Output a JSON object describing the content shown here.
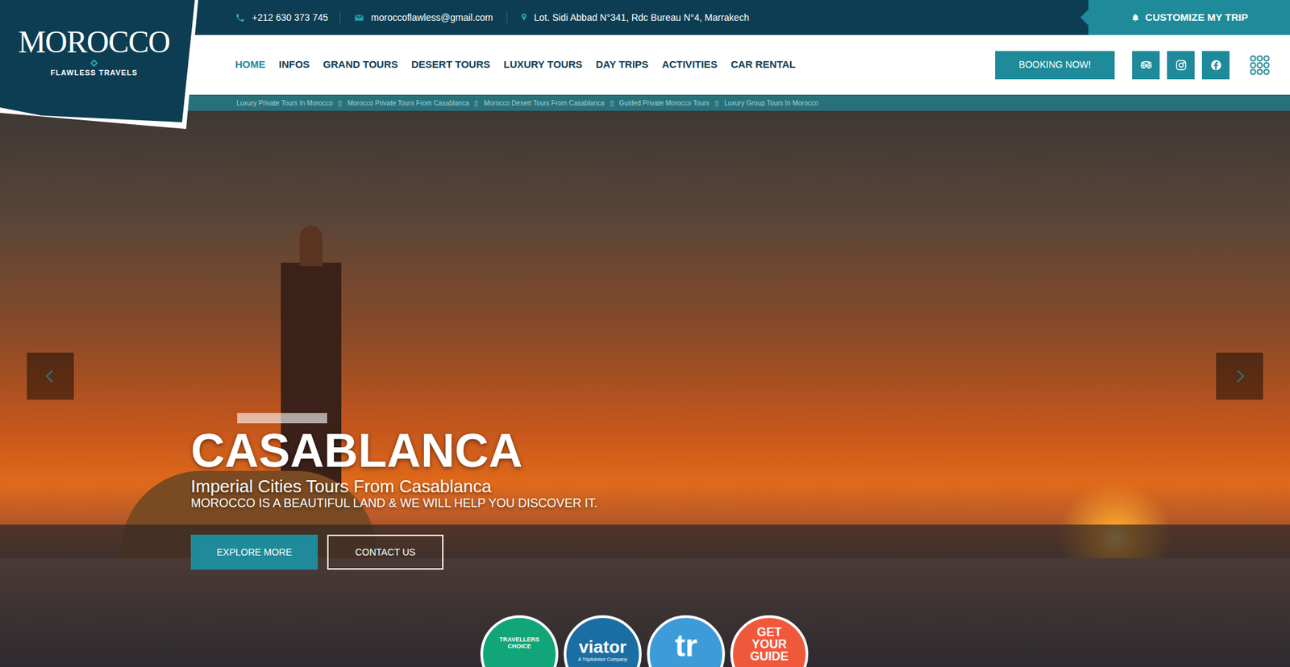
{
  "topbar": {
    "phone": "+212 630 373 745",
    "email": "moroccoflawless@gmail.com",
    "address": "Lot. Sidi Abbad N°341, Rdc Bureau N°4, Marrakech",
    "customize": "CUSTOMIZE MY TRIP"
  },
  "logo": {
    "title": "MOROCCO",
    "subtitle": "FLAWLESS TRAVELS"
  },
  "nav": [
    {
      "label": "HOME",
      "selected": true
    },
    {
      "label": "INFOS",
      "selected": false
    },
    {
      "label": "GRAND TOURS",
      "selected": false
    },
    {
      "label": "DESERT TOURS",
      "selected": false
    },
    {
      "label": "LUXURY TOURS",
      "selected": false
    },
    {
      "label": "DAY TRIPS",
      "selected": false
    },
    {
      "label": "ACTIVITIES",
      "selected": false
    },
    {
      "label": "CAR RENTAL",
      "selected": false
    }
  ],
  "booking": "BOOKING NOW!",
  "ticker": {
    "separator": "▯",
    "items": [
      "Luxury Private Tours In Morocco",
      "Morocco Private Tours From Casablanca",
      "Morocco Desert Tours From Casablanca",
      "Guided Private Morocco Tours",
      "Luxury Group Tours In Morocco"
    ]
  },
  "hero": {
    "title": "CASABLANCA",
    "subtitle": "Imperial Cities Tours From Casablanca",
    "tagline": "MOROCCO IS A BEAUTIFUL LAND & WE WILL HELP YOU DISCOVER IT.",
    "buttons": [
      "EXPLORE MORE",
      "CONTACT US"
    ]
  },
  "badges": [
    {
      "label": "TRAVELLERS CHOICE",
      "sub": "",
      "color": "#12a57a"
    },
    {
      "label": "viator",
      "sub": "A TripAdvisor Company",
      "color": "#1a6ea3"
    },
    {
      "label": "tr",
      "sub": "",
      "color": "#3d9bd8"
    },
    {
      "label": "GET YOUR GUIDE",
      "sub": "",
      "color": "#f0583b"
    }
  ]
}
